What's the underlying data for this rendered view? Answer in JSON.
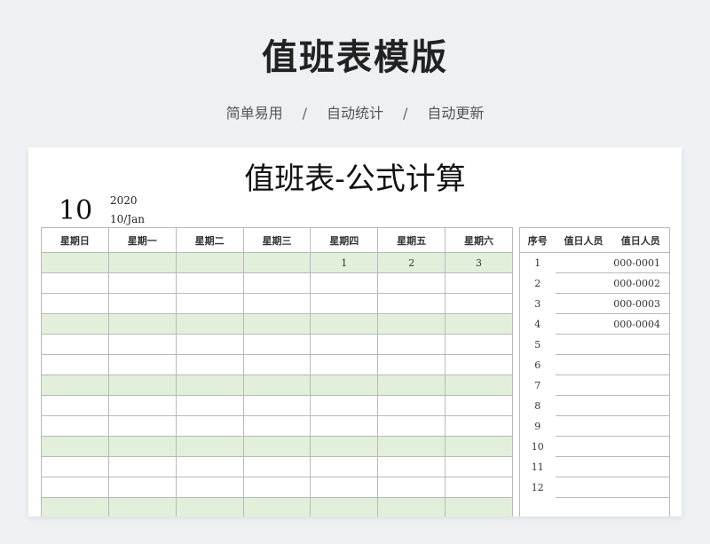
{
  "banner": {
    "title": "值班表模版",
    "tags": [
      "简单易用",
      "自动统计",
      "自动更新"
    ],
    "separator": "/"
  },
  "sheet": {
    "title": "值班表-公式计算",
    "month": "10",
    "year": "2020",
    "day_month": "10/Jan"
  },
  "calendar": {
    "headers": [
      "星期日",
      "星期一",
      "星期二",
      "星期三",
      "星期四",
      "星期五",
      "星期六"
    ],
    "rows": [
      [
        "",
        "",
        "",
        "",
        "1",
        "2",
        "3"
      ],
      [
        "",
        "",
        "",
        "",
        "",
        "",
        ""
      ],
      [
        "",
        "",
        "",
        "",
        "",
        "",
        ""
      ],
      [
        "",
        "",
        "",
        "",
        "",
        "",
        ""
      ],
      [
        "",
        "",
        "",
        "",
        "",
        "",
        ""
      ],
      [
        "",
        "",
        "",
        "",
        "",
        "",
        ""
      ],
      [
        "",
        "",
        "",
        "",
        "",
        "",
        ""
      ],
      [
        "",
        "",
        "",
        "",
        "",
        "",
        ""
      ],
      [
        "",
        "",
        "",
        "",
        "",
        "",
        ""
      ],
      [
        "",
        "",
        "",
        "",
        "",
        "",
        ""
      ],
      [
        "",
        "",
        "",
        "",
        "",
        "",
        ""
      ],
      [
        "",
        "",
        "",
        "",
        "",
        "",
        ""
      ],
      [
        "",
        "",
        "",
        "",
        "",
        "",
        ""
      ]
    ],
    "green_rows": [
      0,
      3,
      6,
      9,
      12
    ]
  },
  "duty": {
    "headers": [
      "序号",
      "值日人员",
      "值日人员"
    ],
    "rows": [
      [
        "1",
        "",
        "000-0001"
      ],
      [
        "2",
        "",
        "000-0002"
      ],
      [
        "3",
        "",
        "000-0003"
      ],
      [
        "4",
        "",
        "000-0004"
      ],
      [
        "5",
        "",
        ""
      ],
      [
        "6",
        "",
        ""
      ],
      [
        "7",
        "",
        ""
      ],
      [
        "8",
        "",
        ""
      ],
      [
        "9",
        "",
        ""
      ],
      [
        "10",
        "",
        ""
      ],
      [
        "11",
        "",
        ""
      ],
      [
        "12",
        "",
        ""
      ],
      [
        "",
        "",
        ""
      ]
    ]
  },
  "colors": {
    "green_row": "#e2efda",
    "grid": "#b9b9b9"
  }
}
